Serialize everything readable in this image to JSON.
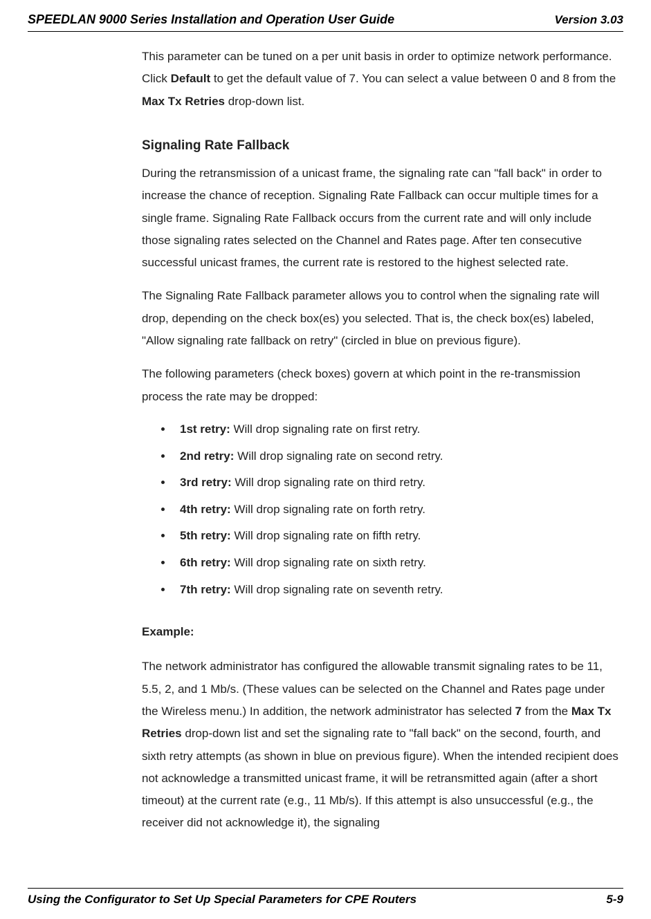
{
  "header": {
    "title": "SPEEDLAN 9000 Series Installation and Operation User Guide",
    "version": "Version 3.03"
  },
  "intro": {
    "p1_a": "This parameter can be tuned on a per unit basis in order to optimize network performance. Click ",
    "p1_bold1": "Default",
    "p1_b": " to get the default value of 7. You can select a value between 0 and 8 from the ",
    "p1_bold2": "Max Tx Retries",
    "p1_c": " drop-down list."
  },
  "section": {
    "heading": "Signaling Rate Fallback",
    "p1": "During the retransmission of a unicast frame, the signaling rate can \"fall back\" in order to increase the chance of reception. Signaling Rate Fallback can occur multiple times for a single frame. Signaling Rate Fallback occurs from the current rate and will only include those signaling rates selected on the Channel and Rates page. After ten consecutive successful unicast frames, the current rate is restored to the highest selected rate.",
    "p2": "The Signaling Rate Fallback parameter allows you to control when the signaling rate will drop, depending on the check box(es) you selected. That is, the check box(es) labeled, \"Allow signaling rate fallback on retry\" (circled in blue on previous figure).",
    "p3": "The following parameters (check boxes) govern at which point in the re-transmission process the rate may be dropped:"
  },
  "retries": [
    {
      "label": "1st retry:",
      "desc": " Will drop signaling rate on first retry."
    },
    {
      "label": "2nd retry:",
      "desc": " Will drop signaling rate on second retry."
    },
    {
      "label": "3rd retry:",
      "desc": " Will drop signaling rate on third retry."
    },
    {
      "label": "4th retry:",
      "desc": " Will drop signaling rate on forth retry."
    },
    {
      "label": "5th retry:",
      "desc": " Will drop signaling rate on fifth retry."
    },
    {
      "label": "6th retry:",
      "desc": " Will drop signaling rate on sixth retry."
    },
    {
      "label": "7th retry:",
      "desc": " Will drop signaling rate on seventh retry."
    }
  ],
  "example": {
    "label": "Example:",
    "p1_a": "The network administrator has configured the allowable transmit signaling rates to be 11, 5.5, 2, and 1 Mb/s. (These values can be selected on the Channel and Rates page under the Wireless menu.) In addition, the network administrator has selected ",
    "p1_bold1": "7",
    "p1_b": " from the ",
    "p1_bold2": "Max Tx Retries",
    "p1_c": " drop-down list and set the signaling rate to \"fall back\" on the second, fourth, and sixth retry attempts (as shown in blue on previous figure). When the intended recipient does not acknowledge a transmitted unicast frame, it will be retransmitted again (after a short timeout) at the current rate (e.g., 11 Mb/s). If this attempt is also unsuccessful (e.g., the receiver did not acknowledge it), the signaling"
  },
  "footer": {
    "left": "Using the Configurator to Set Up Special Parameters for CPE Routers",
    "right": "5-9"
  }
}
